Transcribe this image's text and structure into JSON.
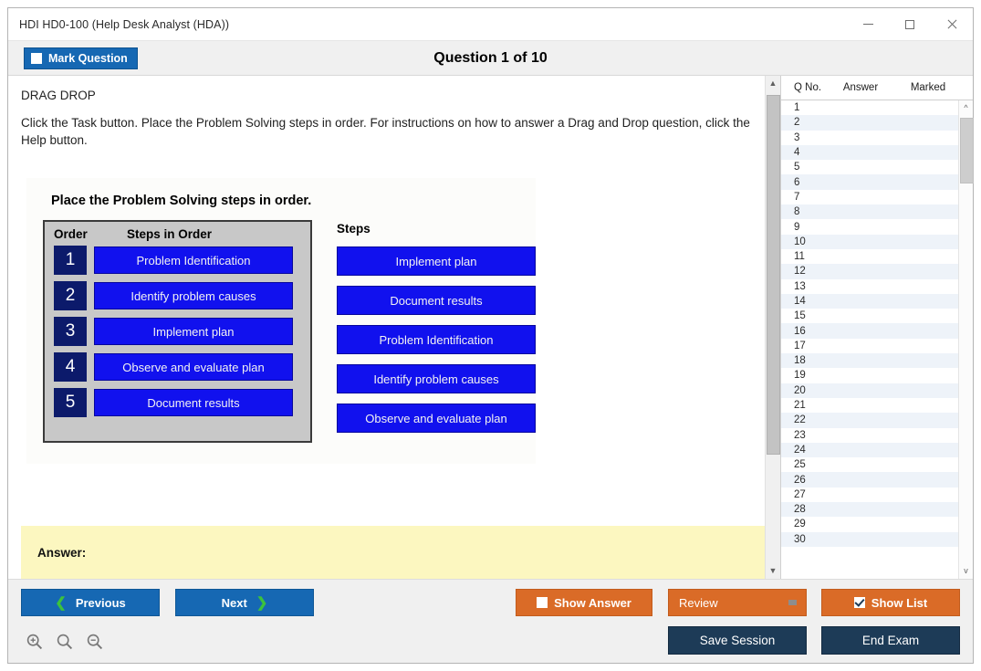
{
  "window": {
    "title": "HDI HD0-100 (Help Desk Analyst (HDA))",
    "minimize": "minimize-icon",
    "maximize": "maximize-icon",
    "close": "close-icon"
  },
  "header": {
    "mark_question_label": "Mark Question",
    "mark_question_checked": false,
    "question_title": "Question 1 of 10"
  },
  "question": {
    "type_label": "DRAG DROP",
    "instructions": "Click the Task button. Place the Problem Solving steps in order. For instructions on how to answer a Drag and Drop question, click the Help button."
  },
  "task": {
    "title": "Place the Problem Solving steps in order.",
    "order_column_header": "Order",
    "steps_in_order_header": "Steps in Order",
    "steps_header": "Steps",
    "ordered_steps": [
      {
        "number": "1",
        "label": "Problem Identification"
      },
      {
        "number": "2",
        "label": "Identify problem causes"
      },
      {
        "number": "3",
        "label": "Implement plan"
      },
      {
        "number": "4",
        "label": "Observe and evaluate plan"
      },
      {
        "number": "5",
        "label": "Document results"
      }
    ],
    "available_steps": [
      "Implement plan",
      "Document results",
      "Problem Identification",
      "Identify problem causes",
      "Observe and evaluate plan"
    ]
  },
  "answer_area": {
    "label": "Answer:",
    "value": ""
  },
  "question_list": {
    "columns": [
      "Q No.",
      "Answer",
      "Marked"
    ],
    "rows": [
      {
        "q": "1",
        "answer": "",
        "marked": ""
      },
      {
        "q": "2",
        "answer": "",
        "marked": ""
      },
      {
        "q": "3",
        "answer": "",
        "marked": ""
      },
      {
        "q": "4",
        "answer": "",
        "marked": ""
      },
      {
        "q": "5",
        "answer": "",
        "marked": ""
      },
      {
        "q": "6",
        "answer": "",
        "marked": ""
      },
      {
        "q": "7",
        "answer": "",
        "marked": ""
      },
      {
        "q": "8",
        "answer": "",
        "marked": ""
      },
      {
        "q": "9",
        "answer": "",
        "marked": ""
      },
      {
        "q": "10",
        "answer": "",
        "marked": ""
      },
      {
        "q": "11",
        "answer": "",
        "marked": ""
      },
      {
        "q": "12",
        "answer": "",
        "marked": ""
      },
      {
        "q": "13",
        "answer": "",
        "marked": ""
      },
      {
        "q": "14",
        "answer": "",
        "marked": ""
      },
      {
        "q": "15",
        "answer": "",
        "marked": ""
      },
      {
        "q": "16",
        "answer": "",
        "marked": ""
      },
      {
        "q": "17",
        "answer": "",
        "marked": ""
      },
      {
        "q": "18",
        "answer": "",
        "marked": ""
      },
      {
        "q": "19",
        "answer": "",
        "marked": ""
      },
      {
        "q": "20",
        "answer": "",
        "marked": ""
      },
      {
        "q": "21",
        "answer": "",
        "marked": ""
      },
      {
        "q": "22",
        "answer": "",
        "marked": ""
      },
      {
        "q": "23",
        "answer": "",
        "marked": ""
      },
      {
        "q": "24",
        "answer": "",
        "marked": ""
      },
      {
        "q": "25",
        "answer": "",
        "marked": ""
      },
      {
        "q": "26",
        "answer": "",
        "marked": ""
      },
      {
        "q": "27",
        "answer": "",
        "marked": ""
      },
      {
        "q": "28",
        "answer": "",
        "marked": ""
      },
      {
        "q": "29",
        "answer": "",
        "marked": ""
      },
      {
        "q": "30",
        "answer": "",
        "marked": ""
      }
    ]
  },
  "footer": {
    "previous_label": "Previous",
    "next_label": "Next",
    "show_answer_label": "Show Answer",
    "show_answer_checked": false,
    "review_label": "Review",
    "show_list_label": "Show List",
    "show_list_checked": true,
    "save_session_label": "Save Session",
    "end_exam_label": "End Exam",
    "zoom_in_icon": "zoom-in-icon",
    "zoom_reset_icon": "zoom-reset-icon",
    "zoom_out_icon": "zoom-out-icon"
  },
  "colors": {
    "accent_blue": "#1668b3",
    "accent_orange": "#da6b27",
    "navy": "#1d3b57",
    "step_blue": "#1111ee",
    "order_navy": "#0c1a6b",
    "answer_yellow": "#fcf7c0",
    "chevron_green": "#3cc23c"
  }
}
